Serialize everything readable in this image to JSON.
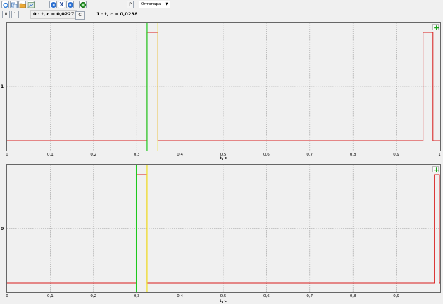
{
  "toolbar": {
    "icons": [
      "refresh-icon",
      "copy-icon",
      "folder-icon",
      "chart-icon",
      "arrow-left-icon",
      "close-icon",
      "arrow-right-icon",
      "settings-icon"
    ],
    "close_label": "X",
    "p_button_label": "P",
    "mode_select_value": "Оптопара"
  },
  "cursor_bar": {
    "tab0_label": "0",
    "tab1_label": "1",
    "cursor0_text": "0 : t, c = 0,0227",
    "c_button_label": "C",
    "cursor1_text": "1 : t, c = 0,0236"
  },
  "colors": {
    "signal": "#d81c1c",
    "cursor0": "#1ec81e",
    "cursor1": "#f0e020",
    "grid": "#9a9a9a"
  },
  "panels": [
    {
      "channel_label": "1",
      "xlabel": "t, c",
      "xticks": [
        "0",
        "0,1",
        "0,2",
        "0,3",
        "0,4",
        "0,5",
        "0,6",
        "0,7",
        "0,8",
        "0,9",
        "1"
      ],
      "xlim": [
        0,
        1
      ],
      "cursor0_t": 0.324,
      "cursor1_t": 0.349,
      "signal": {
        "low": 0.0,
        "high": 1.0,
        "pulses": [
          [
            0.324,
            0.349
          ],
          [
            0.962,
            0.985
          ]
        ]
      }
    },
    {
      "channel_label": "0",
      "xlabel": "t, c",
      "xticks": [
        "0",
        "0,1",
        "0,2",
        "0,3",
        "0,4",
        "0,5",
        "0,6",
        "0,7",
        "0,8",
        "0,9"
      ],
      "xlim": [
        0,
        1
      ],
      "cursor0_t": 0.299,
      "cursor1_t": 0.324,
      "signal": {
        "low": 0.0,
        "high": 1.0,
        "pulses": [
          [
            0.299,
            0.324
          ],
          [
            0.988,
            1.0
          ]
        ]
      }
    }
  ]
}
